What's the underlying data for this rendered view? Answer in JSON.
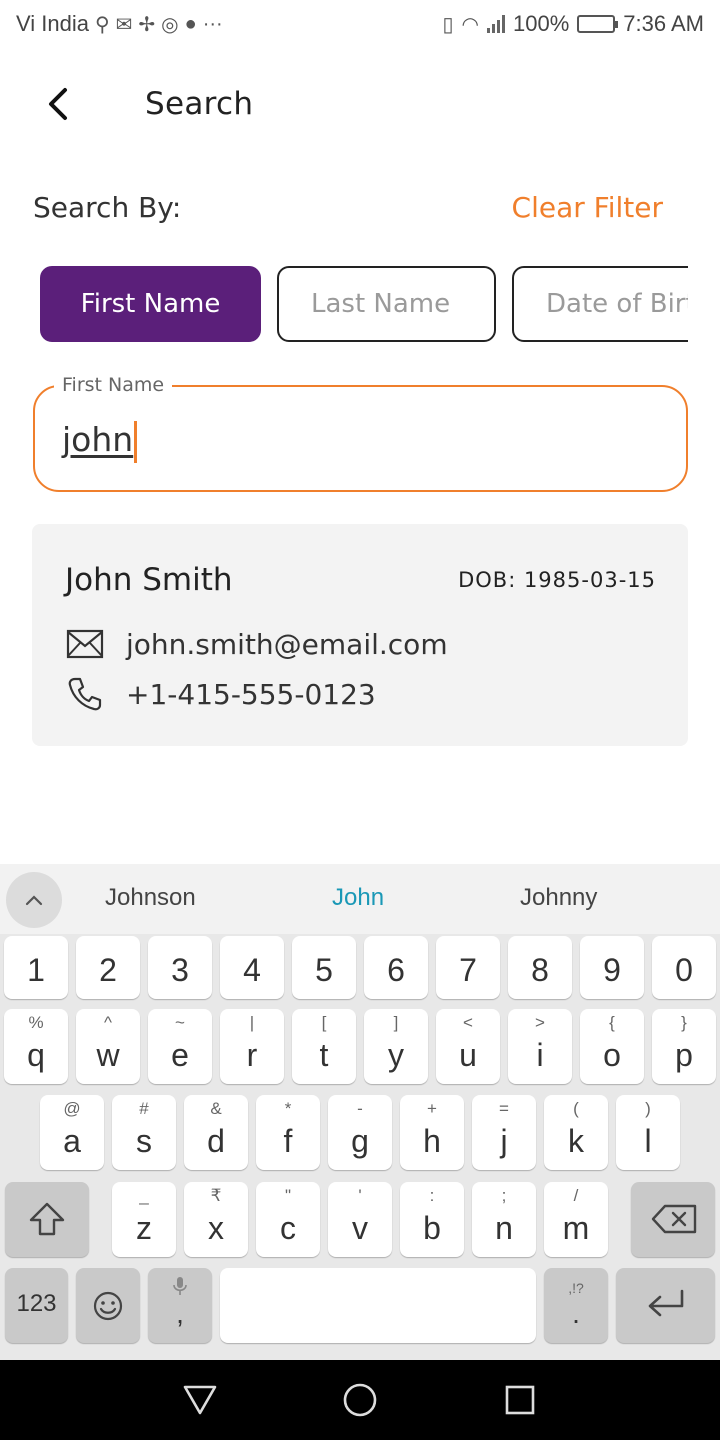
{
  "status_bar": {
    "carrier": "Vi India",
    "battery": "100%",
    "time": "7:36 AM"
  },
  "header": {
    "title": "Search"
  },
  "filter": {
    "search_by_label": "Search By:",
    "clear_label": "Clear Filter",
    "chips": [
      "First Name",
      "Last Name",
      "Date of Birth"
    ],
    "active_chip": "First Name"
  },
  "field": {
    "label": "First Name",
    "value": "john"
  },
  "result": {
    "name": "John Smith",
    "dob": "DOB: 1985-03-15",
    "email": "john.smith@email.com",
    "phone": "+1-415-555-0123"
  },
  "keyboard": {
    "suggestions": [
      "Johnson",
      "John",
      "Johnny"
    ],
    "number_row": [
      "1",
      "2",
      "3",
      "4",
      "5",
      "6",
      "7",
      "8",
      "9",
      "0"
    ],
    "row1": [
      [
        "q",
        "%"
      ],
      [
        "w",
        "^"
      ],
      [
        "e",
        "~"
      ],
      [
        "r",
        "|"
      ],
      [
        "t",
        "["
      ],
      [
        "y",
        "]"
      ],
      [
        "u",
        "<"
      ],
      [
        "i",
        ">"
      ],
      [
        "o",
        "{"
      ],
      [
        "p",
        "}"
      ]
    ],
    "row2": [
      [
        "a",
        "@"
      ],
      [
        "s",
        "#"
      ],
      [
        "d",
        "&"
      ],
      [
        "f",
        "*"
      ],
      [
        "g",
        "-"
      ],
      [
        "h",
        "+"
      ],
      [
        "j",
        "="
      ],
      [
        "k",
        "("
      ],
      [
        "l",
        ")"
      ]
    ],
    "row3": [
      [
        "z",
        "_"
      ],
      [
        "x",
        "₹"
      ],
      [
        "c",
        "\""
      ],
      [
        "v",
        "'"
      ],
      [
        "b",
        ":"
      ],
      [
        "n",
        ";"
      ],
      [
        "m",
        "/"
      ]
    ],
    "numbers_key": "123",
    "comma_key": ",",
    "period_key": ".",
    "period_sub": ",!?"
  },
  "colors": {
    "accent": "#f07f2c",
    "chip_active": "#5b1f7a",
    "suggestion_highlight": "#1a98b6"
  }
}
